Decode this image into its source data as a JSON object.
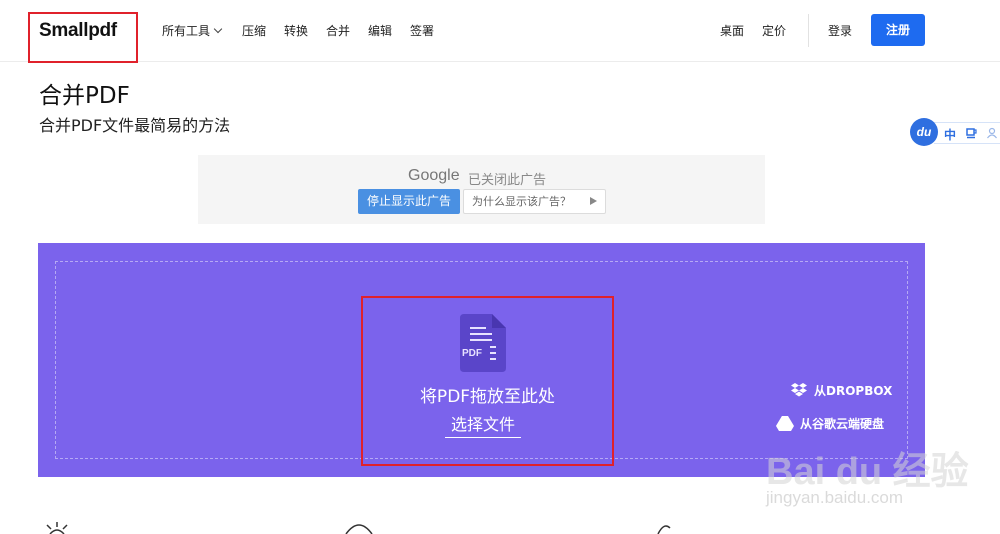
{
  "header": {
    "logo": "Smallpdf",
    "nav": [
      {
        "label": "所有工具",
        "dropdown": true
      },
      {
        "label": "压缩"
      },
      {
        "label": "转换"
      },
      {
        "label": "合并"
      },
      {
        "label": "编辑"
      },
      {
        "label": "签署"
      }
    ],
    "right_links": [
      {
        "label": "桌面"
      },
      {
        "label": "定价"
      }
    ],
    "login_label": "登录",
    "signup_label": "注册"
  },
  "page": {
    "title": "合并PDF",
    "subtitle": "合并PDF文件最简易的方法"
  },
  "baidu_widget": {
    "logo_text": "du",
    "lang_label": "中"
  },
  "ad": {
    "google_label": "Google",
    "closed_text": "已关闭此广告",
    "stop_button": "停止显示此广告",
    "why_button": "为什么显示该广告？"
  },
  "dropzone": {
    "file_icon_text": "PDF",
    "drop_label": "将PDF拖放至此处",
    "choose_file_label": "选择文件",
    "from_dropbox": "从DROPBOX",
    "from_google_drive": "从谷歌云端硬盘"
  },
  "watermark": {
    "brand": "Bai du 经验",
    "url": "jingyan.baidu.com"
  },
  "colors": {
    "accent": "#1e6bf0",
    "dropzone": "#7b63ec",
    "highlight": "#e0212b"
  }
}
